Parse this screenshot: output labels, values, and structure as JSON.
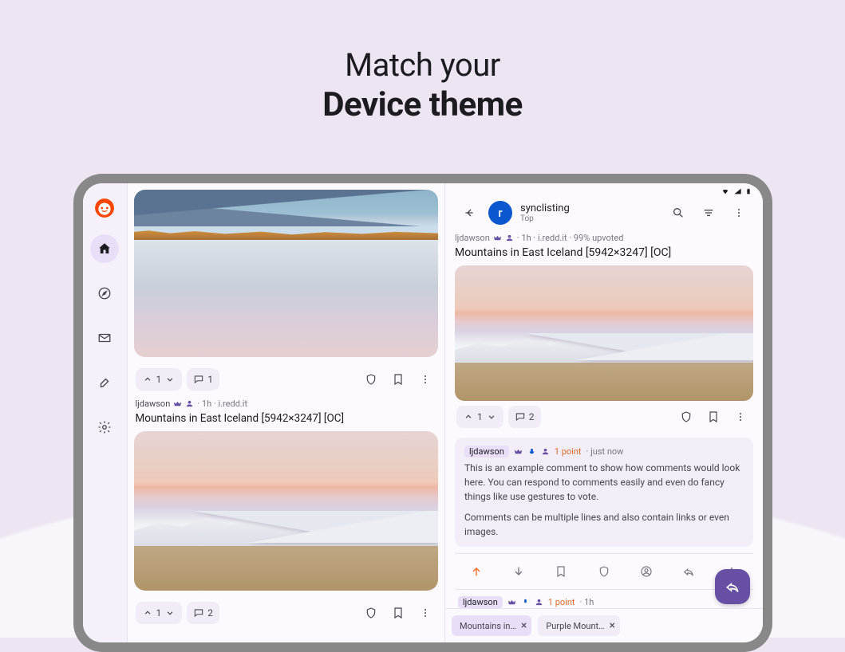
{
  "hero": {
    "line1": "Match your",
    "line2": "Device theme"
  },
  "sidebar": {},
  "left": {
    "card1": {
      "vote": "1",
      "comments": "1"
    },
    "card2": {
      "author": "ljdawson",
      "meta_tail": "· 1h · i.redd.it",
      "title": "Mountains in East Iceland [5942×3247] [OC]",
      "vote": "1",
      "comments": "2"
    }
  },
  "right": {
    "subreddit": "synclisting",
    "sort": "Top",
    "post": {
      "author": "ljdawson",
      "meta_tail": "· 1h · i.redd.it · 99% upvoted",
      "title": "Mountains in East Iceland [5942×3247] [OC]",
      "vote": "1",
      "comments": "2"
    },
    "comment1": {
      "author": "ljdawson",
      "points": "1 point",
      "time": "· just now",
      "body1": "This is an example comment to show how comments would look here. You can respond to comments easily and even do fancy things like use gestures to vote.",
      "body2": "Comments can be multiple lines and also contain links or even images."
    },
    "comment2": {
      "author": "ljdawson",
      "points": "1 point",
      "time": "· 1h"
    },
    "tabs": {
      "t1": "Mountains in…",
      "t2": "Purple Mount…"
    }
  }
}
